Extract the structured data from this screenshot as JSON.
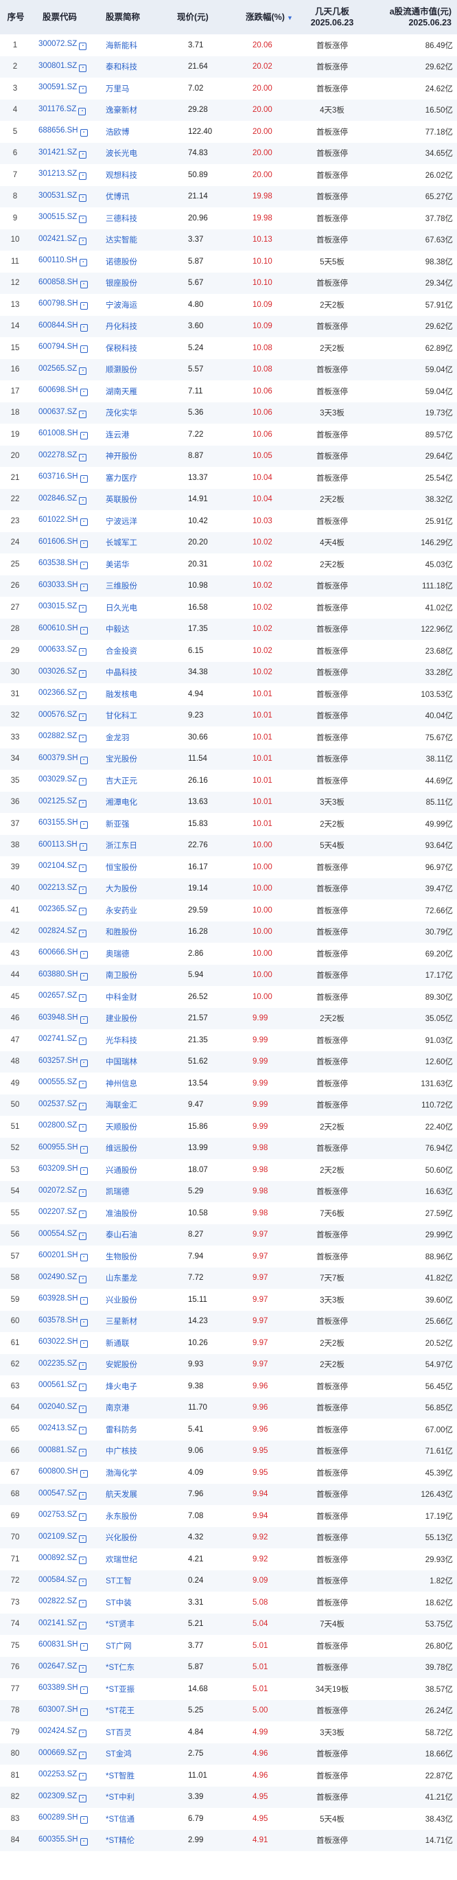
{
  "header": {
    "index": "序号",
    "code": "股票代码",
    "name": "股票简称",
    "price": "现价(元)",
    "change": "涨跌幅(%)",
    "change_sort_icon": "sort-desc-icon",
    "board_line1": "几天几板",
    "board_line2": "2025.06.23",
    "cap_line1": "a股流通市值(元)",
    "cap_line2": "2025.06.23"
  },
  "colors": {
    "header_bg": "#e9eef5",
    "link": "#2a62c9",
    "up": "#d8272c",
    "stripe": "#f4f7fb"
  },
  "rows": [
    {
      "idx": "1",
      "code": "300072.SZ",
      "name": "海新能科",
      "price": "3.71",
      "chg": "20.06",
      "board": "首板涨停",
      "cap": "86.49亿"
    },
    {
      "idx": "2",
      "code": "300801.SZ",
      "name": "泰和科技",
      "price": "21.64",
      "chg": "20.02",
      "board": "首板涨停",
      "cap": "29.62亿"
    },
    {
      "idx": "3",
      "code": "300591.SZ",
      "name": "万里马",
      "price": "7.02",
      "chg": "20.00",
      "board": "首板涨停",
      "cap": "24.62亿"
    },
    {
      "idx": "4",
      "code": "301176.SZ",
      "name": "逸豪新材",
      "price": "29.28",
      "chg": "20.00",
      "board": "4天3板",
      "cap": "16.50亿"
    },
    {
      "idx": "5",
      "code": "688656.SH",
      "name": "浩欧博",
      "price": "122.40",
      "chg": "20.00",
      "board": "首板涨停",
      "cap": "77.18亿"
    },
    {
      "idx": "6",
      "code": "301421.SZ",
      "name": "波长光电",
      "price": "74.83",
      "chg": "20.00",
      "board": "首板涨停",
      "cap": "34.65亿"
    },
    {
      "idx": "7",
      "code": "301213.SZ",
      "name": "观想科技",
      "price": "50.89",
      "chg": "20.00",
      "board": "首板涨停",
      "cap": "26.02亿"
    },
    {
      "idx": "8",
      "code": "300531.SZ",
      "name": "优博讯",
      "price": "21.14",
      "chg": "19.98",
      "board": "首板涨停",
      "cap": "65.27亿"
    },
    {
      "idx": "9",
      "code": "300515.SZ",
      "name": "三德科技",
      "price": "20.96",
      "chg": "19.98",
      "board": "首板涨停",
      "cap": "37.78亿"
    },
    {
      "idx": "10",
      "code": "002421.SZ",
      "name": "达实智能",
      "price": "3.37",
      "chg": "10.13",
      "board": "首板涨停",
      "cap": "67.63亿"
    },
    {
      "idx": "11",
      "code": "600110.SH",
      "name": "诺德股份",
      "price": "5.87",
      "chg": "10.10",
      "board": "5天5板",
      "cap": "98.38亿"
    },
    {
      "idx": "12",
      "code": "600858.SH",
      "name": "银座股份",
      "price": "5.67",
      "chg": "10.10",
      "board": "首板涨停",
      "cap": "29.34亿"
    },
    {
      "idx": "13",
      "code": "600798.SH",
      "name": "宁波海运",
      "price": "4.80",
      "chg": "10.09",
      "board": "2天2板",
      "cap": "57.91亿"
    },
    {
      "idx": "14",
      "code": "600844.SH",
      "name": "丹化科技",
      "price": "3.60",
      "chg": "10.09",
      "board": "首板涨停",
      "cap": "29.62亿"
    },
    {
      "idx": "15",
      "code": "600794.SH",
      "name": "保税科技",
      "price": "5.24",
      "chg": "10.08",
      "board": "2天2板",
      "cap": "62.89亿"
    },
    {
      "idx": "16",
      "code": "002565.SZ",
      "name": "顺灏股份",
      "price": "5.57",
      "chg": "10.08",
      "board": "首板涨停",
      "cap": "59.04亿"
    },
    {
      "idx": "17",
      "code": "600698.SH",
      "name": "湖南天雁",
      "price": "7.11",
      "chg": "10.06",
      "board": "首板涨停",
      "cap": "59.04亿"
    },
    {
      "idx": "18",
      "code": "000637.SZ",
      "name": "茂化实华",
      "price": "5.36",
      "chg": "10.06",
      "board": "3天3板",
      "cap": "19.73亿"
    },
    {
      "idx": "19",
      "code": "601008.SH",
      "name": "连云港",
      "price": "7.22",
      "chg": "10.06",
      "board": "首板涨停",
      "cap": "89.57亿"
    },
    {
      "idx": "20",
      "code": "002278.SZ",
      "name": "神开股份",
      "price": "8.87",
      "chg": "10.05",
      "board": "首板涨停",
      "cap": "29.64亿"
    },
    {
      "idx": "21",
      "code": "603716.SH",
      "name": "塞力医疗",
      "price": "13.37",
      "chg": "10.04",
      "board": "首板涨停",
      "cap": "25.54亿"
    },
    {
      "idx": "22",
      "code": "002846.SZ",
      "name": "英联股份",
      "price": "14.91",
      "chg": "10.04",
      "board": "2天2板",
      "cap": "38.32亿"
    },
    {
      "idx": "23",
      "code": "601022.SH",
      "name": "宁波远洋",
      "price": "10.42",
      "chg": "10.03",
      "board": "首板涨停",
      "cap": "25.91亿"
    },
    {
      "idx": "24",
      "code": "601606.SH",
      "name": "长城军工",
      "price": "20.20",
      "chg": "10.02",
      "board": "4天4板",
      "cap": "146.29亿"
    },
    {
      "idx": "25",
      "code": "603538.SH",
      "name": "美诺华",
      "price": "20.31",
      "chg": "10.02",
      "board": "2天2板",
      "cap": "45.03亿"
    },
    {
      "idx": "26",
      "code": "603033.SH",
      "name": "三维股份",
      "price": "10.98",
      "chg": "10.02",
      "board": "首板涨停",
      "cap": "111.18亿"
    },
    {
      "idx": "27",
      "code": "003015.SZ",
      "name": "日久光电",
      "price": "16.58",
      "chg": "10.02",
      "board": "首板涨停",
      "cap": "41.02亿"
    },
    {
      "idx": "28",
      "code": "600610.SH",
      "name": "中毅达",
      "price": "17.35",
      "chg": "10.02",
      "board": "首板涨停",
      "cap": "122.96亿"
    },
    {
      "idx": "29",
      "code": "000633.SZ",
      "name": "合金投资",
      "price": "6.15",
      "chg": "10.02",
      "board": "首板涨停",
      "cap": "23.68亿"
    },
    {
      "idx": "30",
      "code": "003026.SZ",
      "name": "中晶科技",
      "price": "34.38",
      "chg": "10.02",
      "board": "首板涨停",
      "cap": "33.28亿"
    },
    {
      "idx": "31",
      "code": "002366.SZ",
      "name": "融发核电",
      "price": "4.94",
      "chg": "10.01",
      "board": "首板涨停",
      "cap": "103.53亿"
    },
    {
      "idx": "32",
      "code": "000576.SZ",
      "name": "甘化科工",
      "price": "9.23",
      "chg": "10.01",
      "board": "首板涨停",
      "cap": "40.04亿"
    },
    {
      "idx": "33",
      "code": "002882.SZ",
      "name": "金龙羽",
      "price": "30.66",
      "chg": "10.01",
      "board": "首板涨停",
      "cap": "75.67亿"
    },
    {
      "idx": "34",
      "code": "600379.SH",
      "name": "宝光股份",
      "price": "11.54",
      "chg": "10.01",
      "board": "首板涨停",
      "cap": "38.11亿"
    },
    {
      "idx": "35",
      "code": "003029.SZ",
      "name": "吉大正元",
      "price": "26.16",
      "chg": "10.01",
      "board": "首板涨停",
      "cap": "44.69亿"
    },
    {
      "idx": "36",
      "code": "002125.SZ",
      "name": "湘潭电化",
      "price": "13.63",
      "chg": "10.01",
      "board": "3天3板",
      "cap": "85.11亿"
    },
    {
      "idx": "37",
      "code": "603155.SH",
      "name": "新亚强",
      "price": "15.83",
      "chg": "10.01",
      "board": "2天2板",
      "cap": "49.99亿"
    },
    {
      "idx": "38",
      "code": "600113.SH",
      "name": "浙江东日",
      "price": "22.76",
      "chg": "10.00",
      "board": "5天4板",
      "cap": "93.64亿"
    },
    {
      "idx": "39",
      "code": "002104.SZ",
      "name": "恒宝股份",
      "price": "16.17",
      "chg": "10.00",
      "board": "首板涨停",
      "cap": "96.97亿"
    },
    {
      "idx": "40",
      "code": "002213.SZ",
      "name": "大为股份",
      "price": "19.14",
      "chg": "10.00",
      "board": "首板涨停",
      "cap": "39.47亿"
    },
    {
      "idx": "41",
      "code": "002365.SZ",
      "name": "永安药业",
      "price": "29.59",
      "chg": "10.00",
      "board": "首板涨停",
      "cap": "72.66亿"
    },
    {
      "idx": "42",
      "code": "002824.SZ",
      "name": "和胜股份",
      "price": "16.28",
      "chg": "10.00",
      "board": "首板涨停",
      "cap": "30.79亿"
    },
    {
      "idx": "43",
      "code": "600666.SH",
      "name": "奥瑞德",
      "price": "2.86",
      "chg": "10.00",
      "board": "首板涨停",
      "cap": "69.20亿"
    },
    {
      "idx": "44",
      "code": "603880.SH",
      "name": "南卫股份",
      "price": "5.94",
      "chg": "10.00",
      "board": "首板涨停",
      "cap": "17.17亿"
    },
    {
      "idx": "45",
      "code": "002657.SZ",
      "name": "中科金财",
      "price": "26.52",
      "chg": "10.00",
      "board": "首板涨停",
      "cap": "89.30亿"
    },
    {
      "idx": "46",
      "code": "603948.SH",
      "name": "建业股份",
      "price": "21.57",
      "chg": "9.99",
      "board": "2天2板",
      "cap": "35.05亿"
    },
    {
      "idx": "47",
      "code": "002741.SZ",
      "name": "光华科技",
      "price": "21.35",
      "chg": "9.99",
      "board": "首板涨停",
      "cap": "91.03亿"
    },
    {
      "idx": "48",
      "code": "603257.SH",
      "name": "中国瑞林",
      "price": "51.62",
      "chg": "9.99",
      "board": "首板涨停",
      "cap": "12.60亿"
    },
    {
      "idx": "49",
      "code": "000555.SZ",
      "name": "神州信息",
      "price": "13.54",
      "chg": "9.99",
      "board": "首板涨停",
      "cap": "131.63亿"
    },
    {
      "idx": "50",
      "code": "002537.SZ",
      "name": "海联金汇",
      "price": "9.47",
      "chg": "9.99",
      "board": "首板涨停",
      "cap": "110.72亿"
    },
    {
      "idx": "51",
      "code": "002800.SZ",
      "name": "天顺股份",
      "price": "15.86",
      "chg": "9.99",
      "board": "2天2板",
      "cap": "22.40亿"
    },
    {
      "idx": "52",
      "code": "600955.SH",
      "name": "维远股份",
      "price": "13.99",
      "chg": "9.98",
      "board": "首板涨停",
      "cap": "76.94亿"
    },
    {
      "idx": "53",
      "code": "603209.SH",
      "name": "兴通股份",
      "price": "18.07",
      "chg": "9.98",
      "board": "2天2板",
      "cap": "50.60亿"
    },
    {
      "idx": "54",
      "code": "002072.SZ",
      "name": "凯瑞德",
      "price": "5.29",
      "chg": "9.98",
      "board": "首板涨停",
      "cap": "16.63亿"
    },
    {
      "idx": "55",
      "code": "002207.SZ",
      "name": "准油股份",
      "price": "10.58",
      "chg": "9.98",
      "board": "7天6板",
      "cap": "27.59亿"
    },
    {
      "idx": "56",
      "code": "000554.SZ",
      "name": "泰山石油",
      "price": "8.27",
      "chg": "9.97",
      "board": "首板涨停",
      "cap": "29.99亿"
    },
    {
      "idx": "57",
      "code": "600201.SH",
      "name": "生物股份",
      "price": "7.94",
      "chg": "9.97",
      "board": "首板涨停",
      "cap": "88.96亿"
    },
    {
      "idx": "58",
      "code": "002490.SZ",
      "name": "山东墨龙",
      "price": "7.72",
      "chg": "9.97",
      "board": "7天7板",
      "cap": "41.82亿"
    },
    {
      "idx": "59",
      "code": "603928.SH",
      "name": "兴业股份",
      "price": "15.11",
      "chg": "9.97",
      "board": "3天3板",
      "cap": "39.60亿"
    },
    {
      "idx": "60",
      "code": "603578.SH",
      "name": "三星新材",
      "price": "14.23",
      "chg": "9.97",
      "board": "首板涨停",
      "cap": "25.66亿"
    },
    {
      "idx": "61",
      "code": "603022.SH",
      "name": "新通联",
      "price": "10.26",
      "chg": "9.97",
      "board": "2天2板",
      "cap": "20.52亿"
    },
    {
      "idx": "62",
      "code": "002235.SZ",
      "name": "安妮股份",
      "price": "9.93",
      "chg": "9.97",
      "board": "2天2板",
      "cap": "54.97亿"
    },
    {
      "idx": "63",
      "code": "000561.SZ",
      "name": "烽火电子",
      "price": "9.38",
      "chg": "9.96",
      "board": "首板涨停",
      "cap": "56.45亿"
    },
    {
      "idx": "64",
      "code": "002040.SZ",
      "name": "南京港",
      "price": "11.70",
      "chg": "9.96",
      "board": "首板涨停",
      "cap": "56.85亿"
    },
    {
      "idx": "65",
      "code": "002413.SZ",
      "name": "雷科防务",
      "price": "5.41",
      "chg": "9.96",
      "board": "首板涨停",
      "cap": "67.00亿"
    },
    {
      "idx": "66",
      "code": "000881.SZ",
      "name": "中广核技",
      "price": "9.06",
      "chg": "9.95",
      "board": "首板涨停",
      "cap": "71.61亿"
    },
    {
      "idx": "67",
      "code": "600800.SH",
      "name": "渤海化学",
      "price": "4.09",
      "chg": "9.95",
      "board": "首板涨停",
      "cap": "45.39亿"
    },
    {
      "idx": "68",
      "code": "000547.SZ",
      "name": "航天发展",
      "price": "7.96",
      "chg": "9.94",
      "board": "首板涨停",
      "cap": "126.43亿"
    },
    {
      "idx": "69",
      "code": "002753.SZ",
      "name": "永东股份",
      "price": "7.08",
      "chg": "9.94",
      "board": "首板涨停",
      "cap": "17.19亿"
    },
    {
      "idx": "70",
      "code": "002109.SZ",
      "name": "兴化股份",
      "price": "4.32",
      "chg": "9.92",
      "board": "首板涨停",
      "cap": "55.13亿"
    },
    {
      "idx": "71",
      "code": "000892.SZ",
      "name": "欢瑞世纪",
      "price": "4.21",
      "chg": "9.92",
      "board": "首板涨停",
      "cap": "29.93亿"
    },
    {
      "idx": "72",
      "code": "000584.SZ",
      "name": "ST工智",
      "price": "0.24",
      "chg": "9.09",
      "board": "首板涨停",
      "cap": "1.82亿"
    },
    {
      "idx": "73",
      "code": "002822.SZ",
      "name": "ST中装",
      "price": "3.31",
      "chg": "5.08",
      "board": "首板涨停",
      "cap": "18.62亿"
    },
    {
      "idx": "74",
      "code": "002141.SZ",
      "name": "*ST贤丰",
      "price": "5.21",
      "chg": "5.04",
      "board": "7天4板",
      "cap": "53.75亿"
    },
    {
      "idx": "75",
      "code": "600831.SH",
      "name": "ST广网",
      "price": "3.77",
      "chg": "5.01",
      "board": "首板涨停",
      "cap": "26.80亿"
    },
    {
      "idx": "76",
      "code": "002647.SZ",
      "name": "*ST仁东",
      "price": "5.87",
      "chg": "5.01",
      "board": "首板涨停",
      "cap": "39.78亿"
    },
    {
      "idx": "77",
      "code": "603389.SH",
      "name": "*ST亚振",
      "price": "14.68",
      "chg": "5.01",
      "board": "34天19板",
      "cap": "38.57亿"
    },
    {
      "idx": "78",
      "code": "603007.SH",
      "name": "*ST花王",
      "price": "5.25",
      "chg": "5.00",
      "board": "首板涨停",
      "cap": "26.24亿"
    },
    {
      "idx": "79",
      "code": "002424.SZ",
      "name": "ST百灵",
      "price": "4.84",
      "chg": "4.99",
      "board": "3天3板",
      "cap": "58.72亿"
    },
    {
      "idx": "80",
      "code": "000669.SZ",
      "name": "ST金鸿",
      "price": "2.75",
      "chg": "4.96",
      "board": "首板涨停",
      "cap": "18.66亿"
    },
    {
      "idx": "81",
      "code": "002253.SZ",
      "name": "*ST智胜",
      "price": "11.01",
      "chg": "4.96",
      "board": "首板涨停",
      "cap": "22.87亿"
    },
    {
      "idx": "82",
      "code": "002309.SZ",
      "name": "*ST中利",
      "price": "3.39",
      "chg": "4.95",
      "board": "首板涨停",
      "cap": "41.21亿"
    },
    {
      "idx": "83",
      "code": "600289.SH",
      "name": "*ST信通",
      "price": "6.79",
      "chg": "4.95",
      "board": "5天4板",
      "cap": "38.43亿"
    },
    {
      "idx": "84",
      "code": "600355.SH",
      "name": "*ST精伦",
      "price": "2.99",
      "chg": "4.91",
      "board": "首板涨停",
      "cap": "14.71亿"
    }
  ]
}
